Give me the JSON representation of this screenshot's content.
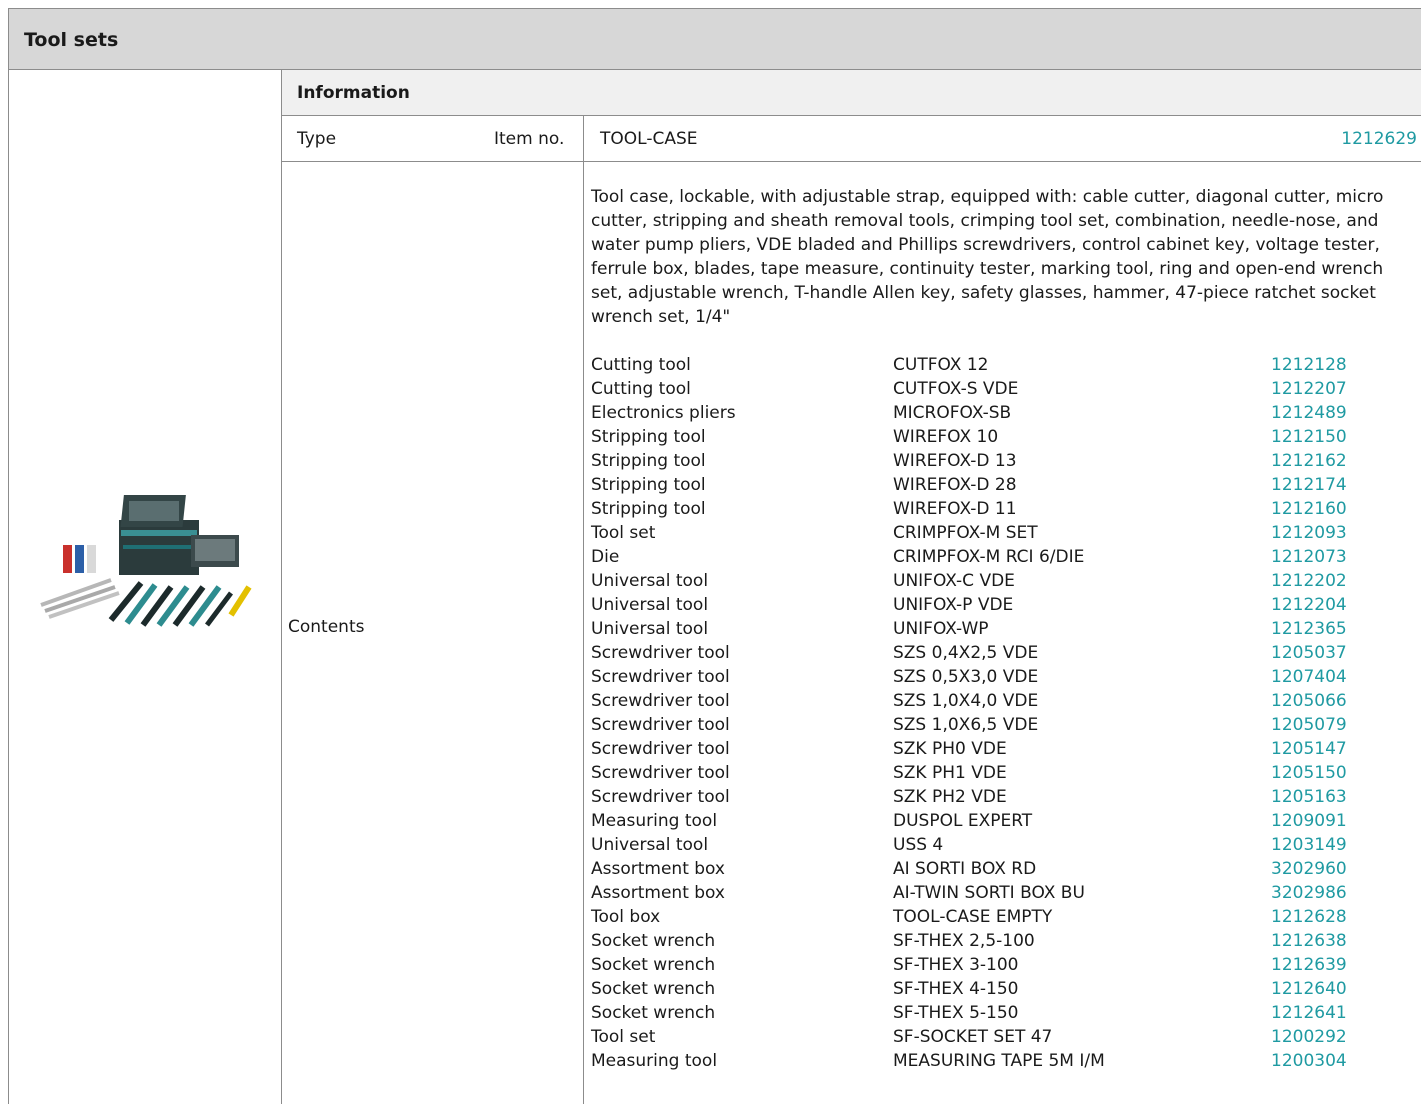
{
  "section_title": "Tool sets",
  "info_header": "Information",
  "type_row": {
    "type_label": "Type",
    "item_label": "Item no.",
    "type_value": "TOOL-CASE",
    "item_value": "1212629"
  },
  "contents_label": "Contents",
  "description": "Tool case, lockable, with adjustable strap, equipped with: cable cutter, diagonal cutter, micro cutter, stripping and sheath removal tools, crimping tool set, combination, needle-nose, and water pump pliers, VDE bladed and Phillips screwdrivers, control cabinet key, voltage tester, ferrule box, blades, tape measure, continuity tester, marking tool, ring and open-end wrench set, adjustable wrench, T-handle Allen key, safety glasses, hammer, 47-piece ratchet socket wrench set, 1/4\"",
  "items": [
    {
      "category": "Cutting tool",
      "type": "CUTFOX 12",
      "item_no": "1212128"
    },
    {
      "category": "Cutting tool",
      "type": "CUTFOX-S VDE",
      "item_no": "1212207"
    },
    {
      "category": "Electronics pliers",
      "type": "MICROFOX-SB",
      "item_no": "1212489"
    },
    {
      "category": "Stripping tool",
      "type": "WIREFOX 10",
      "item_no": "1212150"
    },
    {
      "category": "Stripping tool",
      "type": "WIREFOX-D 13",
      "item_no": "1212162"
    },
    {
      "category": "Stripping tool",
      "type": "WIREFOX-D 28",
      "item_no": "1212174"
    },
    {
      "category": "Stripping tool",
      "type": "WIREFOX-D 11",
      "item_no": "1212160"
    },
    {
      "category": "Tool set",
      "type": "CRIMPFOX-M SET",
      "item_no": "1212093"
    },
    {
      "category": "Die",
      "type": "CRIMPFOX-M RCI 6/DIE",
      "item_no": "1212073"
    },
    {
      "category": "Universal tool",
      "type": "UNIFOX-C VDE",
      "item_no": "1212202"
    },
    {
      "category": "Universal tool",
      "type": "UNIFOX-P VDE",
      "item_no": "1212204"
    },
    {
      "category": "Universal tool",
      "type": "UNIFOX-WP",
      "item_no": "1212365"
    },
    {
      "category": "Screwdriver tool",
      "type": "SZS 0,4X2,5 VDE",
      "item_no": "1205037"
    },
    {
      "category": "Screwdriver tool",
      "type": "SZS 0,5X3,0 VDE",
      "item_no": "1207404"
    },
    {
      "category": "Screwdriver tool",
      "type": "SZS 1,0X4,0 VDE",
      "item_no": "1205066"
    },
    {
      "category": "Screwdriver tool",
      "type": "SZS 1,0X6,5 VDE",
      "item_no": "1205079"
    },
    {
      "category": "Screwdriver tool",
      "type": "SZK PH0 VDE",
      "item_no": "1205147"
    },
    {
      "category": "Screwdriver tool",
      "type": "SZK PH1 VDE",
      "item_no": "1205150"
    },
    {
      "category": "Screwdriver tool",
      "type": "SZK PH2 VDE",
      "item_no": "1205163"
    },
    {
      "category": "Measuring tool",
      "type": "DUSPOL EXPERT",
      "item_no": "1209091"
    },
    {
      "category": "Universal tool",
      "type": "USS 4",
      "item_no": "1203149"
    },
    {
      "category": "Assortment box",
      "type": "AI SORTI BOX RD",
      "item_no": "3202960"
    },
    {
      "category": "Assortment box",
      "type": "AI-TWIN SORTI BOX BU",
      "item_no": "3202986"
    },
    {
      "category": "Tool box",
      "type": "TOOL-CASE EMPTY",
      "item_no": "1212628"
    },
    {
      "category": "Socket wrench",
      "type": "SF-THEX 2,5-100",
      "item_no": "1212638"
    },
    {
      "category": "Socket wrench",
      "type": "SF-THEX 3-100",
      "item_no": "1212639"
    },
    {
      "category": "Socket wrench",
      "type": "SF-THEX 4-150",
      "item_no": "1212640"
    },
    {
      "category": "Socket wrench",
      "type": "SF-THEX 5-150",
      "item_no": "1212641"
    },
    {
      "category": "Tool set",
      "type": "SF-SOCKET SET 47",
      "item_no": "1200292"
    },
    {
      "category": "Measuring tool",
      "type": "MEASURING TAPE 5M I/M",
      "item_no": "1200304"
    }
  ],
  "colors": {
    "link": "#1f9aa2",
    "title_bg": "#d7d7d7",
    "header_bg": "#f0f0f0",
    "border": "#8c8c8c"
  }
}
